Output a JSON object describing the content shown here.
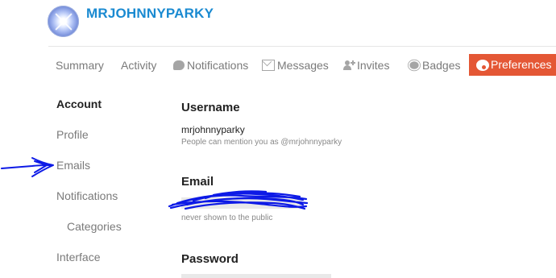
{
  "header": {
    "username": "MRJOHNNYPARKY"
  },
  "tabs": [
    {
      "label": "Summary",
      "icon": ""
    },
    {
      "label": "Activity",
      "icon": ""
    },
    {
      "label": "Notifications",
      "icon": "comment-icon"
    },
    {
      "label": "Messages",
      "icon": "envelope-icon"
    },
    {
      "label": "Invites",
      "icon": "user-plus-icon"
    },
    {
      "label": "Badges",
      "icon": "certificate-icon"
    },
    {
      "label": "Preferences",
      "icon": "gear-icon"
    }
  ],
  "sidebar": {
    "items": [
      {
        "label": "Account"
      },
      {
        "label": "Profile"
      },
      {
        "label": "Emails"
      },
      {
        "label": "Notifications"
      },
      {
        "label": "Categories"
      },
      {
        "label": "Interface"
      }
    ]
  },
  "main": {
    "username": {
      "title": "Username",
      "value": "mrjohnnyparky",
      "help": "People can mention you as @mrjohnnyparky"
    },
    "email": {
      "title": "Email",
      "help": "never shown to the public"
    },
    "password": {
      "title": "Password"
    }
  },
  "colors": {
    "brand_link": "#1a8ad1",
    "active_tab": "#e45735",
    "annotation": "#0d1ae6"
  }
}
